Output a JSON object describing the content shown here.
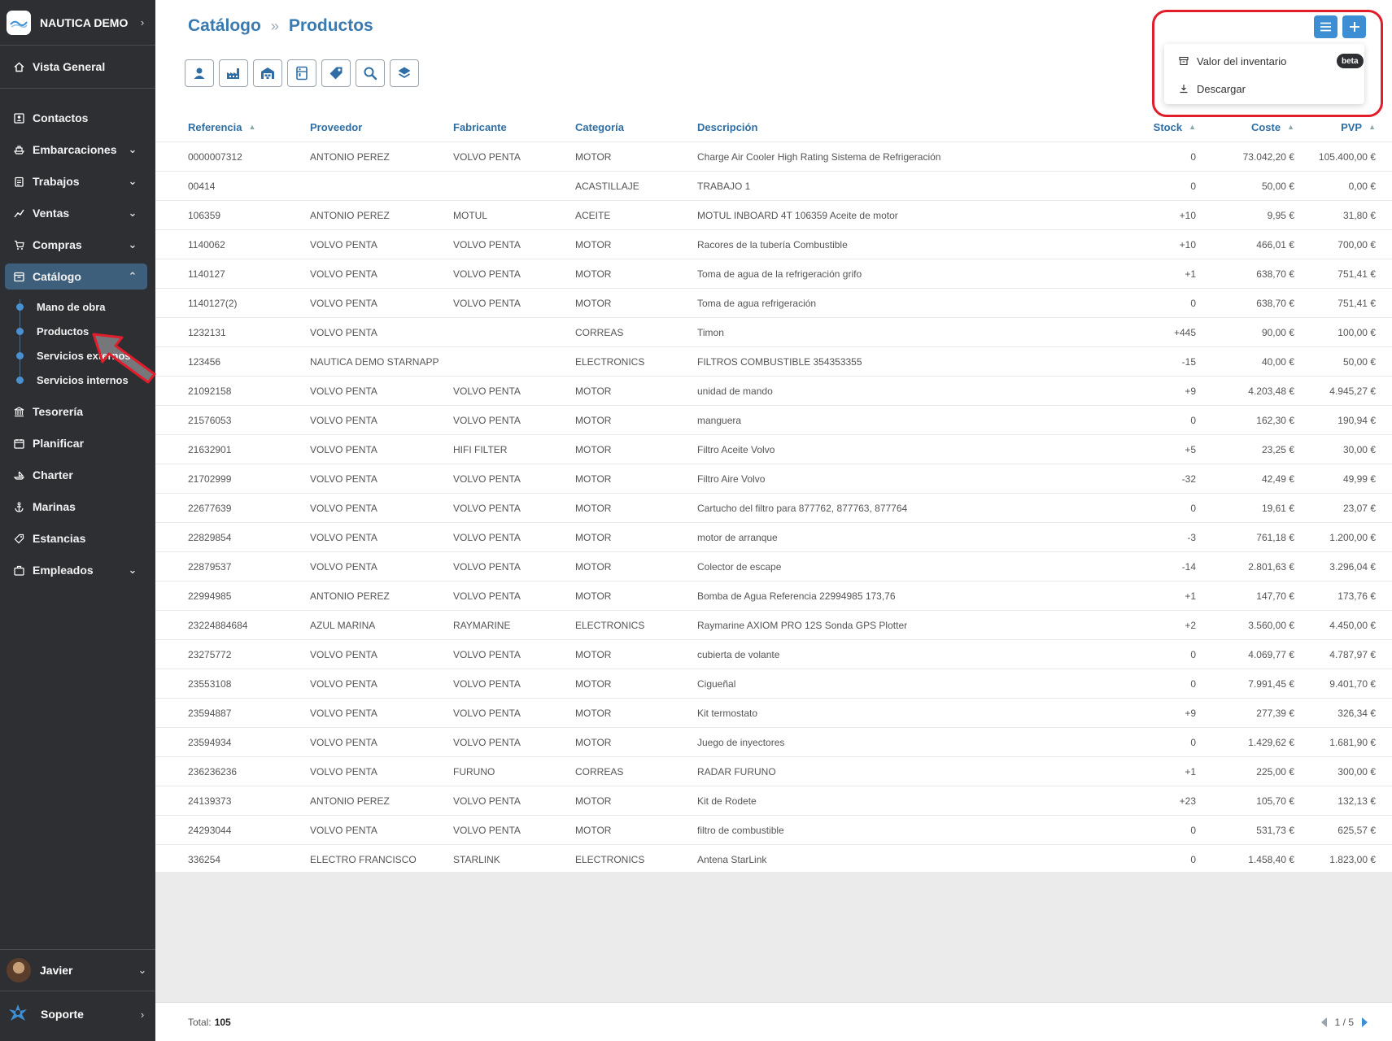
{
  "sidebar": {
    "brand": "NAUTICA DEMO",
    "items": [
      {
        "label": "Vista General",
        "icon": "home-icon"
      },
      {
        "label": "Contactos",
        "icon": "contacts-icon"
      },
      {
        "label": "Embarcaciones",
        "icon": "boat-icon"
      },
      {
        "label": "Trabajos",
        "icon": "clipboard-icon"
      },
      {
        "label": "Ventas",
        "icon": "chart-icon"
      },
      {
        "label": "Compras",
        "icon": "cart-icon"
      },
      {
        "label": "Catálogo",
        "icon": "catalog-icon"
      },
      {
        "label": "Tesorería",
        "icon": "bank-icon"
      },
      {
        "label": "Planificar",
        "icon": "calendar-icon"
      },
      {
        "label": "Charter",
        "icon": "charter-icon"
      },
      {
        "label": "Marinas",
        "icon": "anchor-icon"
      },
      {
        "label": "Estancias",
        "icon": "tag-icon"
      },
      {
        "label": "Empleados",
        "icon": "employees-icon"
      }
    ],
    "sub_items": [
      "Mano de obra",
      "Productos",
      "Servicios externos",
      "Servicios internos"
    ],
    "user": "Javier",
    "support": "Soporte"
  },
  "header": {
    "breadcrumb_parent": "Catálogo",
    "breadcrumb_current": "Productos",
    "toolbar_icons": [
      "person-icon",
      "factory-icon",
      "warehouse-icon",
      "cabinet-icon",
      "tag-icon",
      "search-icon",
      "layers-icon"
    ]
  },
  "dropdown": {
    "items": [
      "Valor del inventario",
      "Descargar"
    ],
    "badge": "beta"
  },
  "table": {
    "columns": [
      "Referencia",
      "Proveedor",
      "Fabricante",
      "Categoría",
      "Descripción",
      "Stock",
      "Coste",
      "PVP"
    ],
    "rows": [
      [
        "0000007312",
        "ANTONIO PEREZ",
        "VOLVO PENTA",
        "MOTOR",
        "Charge Air Cooler High Rating Sistema de Refrigeración",
        "0",
        "73.042,20 €",
        "105.400,00 €"
      ],
      [
        "00414",
        "",
        "",
        "ACASTILLAJE",
        "TRABAJO 1",
        "0",
        "50,00 €",
        "0,00 €"
      ],
      [
        "106359",
        "ANTONIO PEREZ",
        "MOTUL",
        "ACEITE",
        "MOTUL INBOARD 4T 106359 Aceite de motor",
        "+10",
        "9,95 €",
        "31,80 €"
      ],
      [
        "1140062",
        "VOLVO PENTA",
        "VOLVO PENTA",
        "MOTOR",
        "Racores de la tubería Combustible",
        "+10",
        "466,01 €",
        "700,00 €"
      ],
      [
        "1140127",
        "VOLVO PENTA",
        "VOLVO PENTA",
        "MOTOR",
        "Toma de agua de la refrigeración grifo",
        "+1",
        "638,70 €",
        "751,41 €"
      ],
      [
        "1140127(2)",
        "VOLVO PENTA",
        "VOLVO PENTA",
        "MOTOR",
        "Toma de agua refrigeración",
        "0",
        "638,70 €",
        "751,41 €"
      ],
      [
        "1232131",
        "VOLVO PENTA",
        "",
        "CORREAS",
        "Timon",
        "+445",
        "90,00 €",
        "100,00 €"
      ],
      [
        "123456",
        "NAUTICA DEMO STARNAPP",
        "",
        "ELECTRONICS",
        "FILTROS COMBUSTIBLE 354353355",
        "-15",
        "40,00 €",
        "50,00 €"
      ],
      [
        "21092158",
        "VOLVO PENTA",
        "VOLVO PENTA",
        "MOTOR",
        "unidad de mando",
        "+9",
        "4.203,48 €",
        "4.945,27 €"
      ],
      [
        "21576053",
        "VOLVO PENTA",
        "VOLVO PENTA",
        "MOTOR",
        "manguera",
        "0",
        "162,30 €",
        "190,94 €"
      ],
      [
        "21632901",
        "VOLVO PENTA",
        "HIFI FILTER",
        "MOTOR",
        "Filtro Aceite Volvo",
        "+5",
        "23,25 €",
        "30,00 €"
      ],
      [
        "21702999",
        "VOLVO PENTA",
        "VOLVO PENTA",
        "MOTOR",
        "Filtro Aire Volvo",
        "-32",
        "42,49 €",
        "49,99 €"
      ],
      [
        "22677639",
        "VOLVO PENTA",
        "VOLVO PENTA",
        "MOTOR",
        "Cartucho del filtro para 877762, 877763, 877764",
        "0",
        "19,61 €",
        "23,07 €"
      ],
      [
        "22829854",
        "VOLVO PENTA",
        "VOLVO PENTA",
        "MOTOR",
        "motor de arranque",
        "-3",
        "761,18 €",
        "1.200,00 €"
      ],
      [
        "22879537",
        "VOLVO PENTA",
        "VOLVO PENTA",
        "MOTOR",
        "Colector de escape",
        "-14",
        "2.801,63 €",
        "3.296,04 €"
      ],
      [
        "22994985",
        "ANTONIO PEREZ",
        "VOLVO PENTA",
        "MOTOR",
        "Bomba de Agua Referencia 22994985 173,76",
        "+1",
        "147,70 €",
        "173,76 €"
      ],
      [
        "23224884684",
        "AZUL MARINA",
        "RAYMARINE",
        "ELECTRONICS",
        "Raymarine AXIOM PRO 12S Sonda GPS Plotter",
        "+2",
        "3.560,00 €",
        "4.450,00 €"
      ],
      [
        "23275772",
        "VOLVO PENTA",
        "VOLVO PENTA",
        "MOTOR",
        "cubierta de volante",
        "0",
        "4.069,77 €",
        "4.787,97 €"
      ],
      [
        "23553108",
        "VOLVO PENTA",
        "VOLVO PENTA",
        "MOTOR",
        "Cigueñal",
        "0",
        "7.991,45 €",
        "9.401,70 €"
      ],
      [
        "23594887",
        "VOLVO PENTA",
        "VOLVO PENTA",
        "MOTOR",
        "Kit termostato",
        "+9",
        "277,39 €",
        "326,34 €"
      ],
      [
        "23594934",
        "VOLVO PENTA",
        "VOLVO PENTA",
        "MOTOR",
        "Juego de inyectores",
        "0",
        "1.429,62 €",
        "1.681,90 €"
      ],
      [
        "236236236",
        "VOLVO PENTA",
        "FURUNO",
        "CORREAS",
        "RADAR FURUNO",
        "+1",
        "225,00 €",
        "300,00 €"
      ],
      [
        "24139373",
        "ANTONIO PEREZ",
        "VOLVO PENTA",
        "MOTOR",
        "Kit de Rodete",
        "+23",
        "105,70 €",
        "132,13 €"
      ],
      [
        "24293044",
        "VOLVO PENTA",
        "VOLVO PENTA",
        "MOTOR",
        "filtro de combustible",
        "0",
        "531,73 €",
        "625,57 €"
      ],
      [
        "336254",
        "ELECTRO FRANCISCO",
        "STARLINK",
        "ELECTRONICS",
        "Antena StarLink",
        "0",
        "1.458,40 €",
        "1.823,00 €"
      ]
    ]
  },
  "footer": {
    "total_label": "Total:",
    "total_value": "105",
    "page": "1 / 5"
  },
  "colors": {
    "accent": "#3d8ed3",
    "sidebar_bg": "#2d2f33",
    "active_item": "#3e5f7c",
    "highlight": "#e11d2b"
  }
}
